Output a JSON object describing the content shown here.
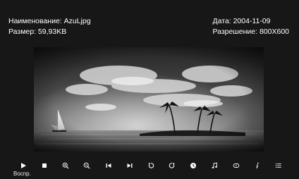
{
  "file_info": {
    "name_line": "Наименование: AzuLjpg",
    "size_line": "Размер: 59,93KB",
    "date_line": "Дата: 2004-11-09",
    "resolution_line": "Разрешение: 800X600"
  },
  "photo": {
    "subject": "tropical-beach-sunset-palms-sailboat"
  },
  "toolbar": {
    "buttons": [
      {
        "name": "play",
        "icon": "play-icon"
      },
      {
        "name": "stop",
        "icon": "stop-icon"
      },
      {
        "name": "zoom-in",
        "icon": "zoom-in-icon"
      },
      {
        "name": "zoom-out",
        "icon": "zoom-out-icon"
      },
      {
        "name": "previous",
        "icon": "skip-previous-icon"
      },
      {
        "name": "next",
        "icon": "skip-next-icon"
      },
      {
        "name": "rotate-left",
        "icon": "rotate-left-icon"
      },
      {
        "name": "rotate-right",
        "icon": "rotate-right-icon"
      },
      {
        "name": "slideshow-timer",
        "icon": "clock-icon"
      },
      {
        "name": "music",
        "icon": "music-note-icon"
      },
      {
        "name": "repeat",
        "icon": "repeat-icon"
      },
      {
        "name": "info",
        "icon": "info-icon"
      },
      {
        "name": "playlist",
        "icon": "list-icon"
      }
    ],
    "caption": "Воспр."
  }
}
